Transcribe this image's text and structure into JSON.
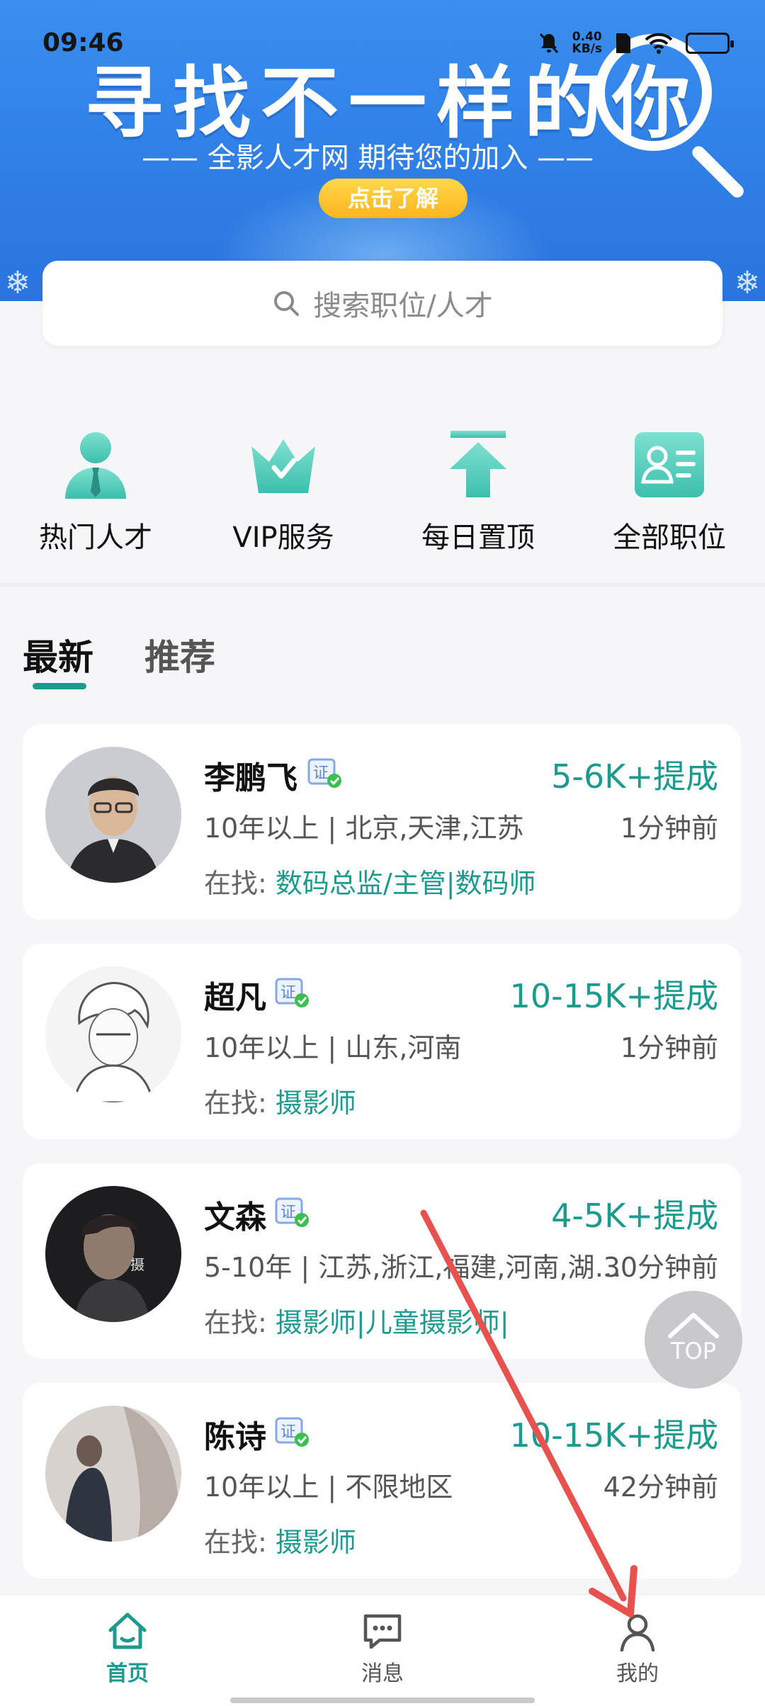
{
  "status": {
    "time": "09:46",
    "net_speed_value": "0.40",
    "net_speed_unit": "KB/s"
  },
  "banner": {
    "headline": "寻找不一样的你",
    "subline": "—— 全影人才网  期待您的加入 ——",
    "cta_label": "点击了解"
  },
  "search": {
    "placeholder": "搜索职位/人才"
  },
  "categories": [
    {
      "label": "热门人才",
      "icon": "person-tie-icon"
    },
    {
      "label": "VIP服务",
      "icon": "crown-icon"
    },
    {
      "label": "每日置顶",
      "icon": "pin-top-icon"
    },
    {
      "label": "全部职位",
      "icon": "id-card-icon"
    }
  ],
  "tabs": {
    "latest": "最新",
    "recommended": "推荐"
  },
  "cards": [
    {
      "name": "李鹏飞",
      "salary": "5-6K+提成",
      "meta": "10年以上 | 北京,天津,江苏",
      "time": "1分钟前",
      "seek_label": "在找:",
      "seek_value": "数码总监/主管|数码师"
    },
    {
      "name": "超凡",
      "salary": "10-15K+提成",
      "meta": "10年以上 | 山东,河南",
      "time": "1分钟前",
      "seek_label": "在找:",
      "seek_value": "摄影师"
    },
    {
      "name": "文森",
      "salary": "4-5K+提成",
      "meta": "5-10年 | 江苏,浙江,福建,河南,湖…",
      "time": "30分钟前",
      "seek_label": "在找:",
      "seek_value": "摄影师|儿童摄影师|"
    },
    {
      "name": "陈诗",
      "salary": "10-15K+提成",
      "meta": "10年以上 | 不限地区",
      "time": "42分钟前",
      "seek_label": "在找:",
      "seek_value": "摄影师"
    }
  ],
  "top_button": {
    "label": "TOP"
  },
  "bottom_nav": [
    {
      "label": "首页",
      "icon": "home-icon",
      "active": true
    },
    {
      "label": "消息",
      "icon": "message-icon",
      "active": false
    },
    {
      "label": "我的",
      "icon": "profile-icon",
      "active": false
    }
  ],
  "colors": {
    "accent": "#1d9a8e",
    "banner": "#3a8ff0",
    "annotation_arrow": "#e8524e"
  }
}
